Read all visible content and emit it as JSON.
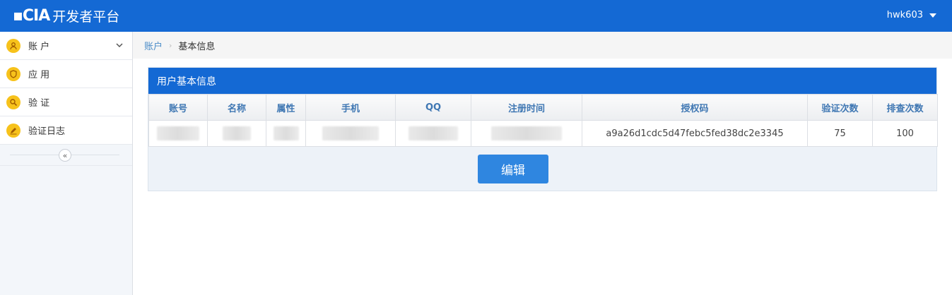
{
  "header": {
    "logo_mark": "▪CIA",
    "title": "开发者平台",
    "username": "hwk603"
  },
  "sidebar": {
    "items": [
      {
        "label": "账 户",
        "icon": "user-icon",
        "expandable": true
      },
      {
        "label": "应 用",
        "icon": "shield-icon",
        "expandable": false
      },
      {
        "label": "验 证",
        "icon": "search-icon",
        "expandable": false
      },
      {
        "label": "验证日志",
        "icon": "pencil-icon",
        "expandable": false
      }
    ],
    "collapse_glyph": "«"
  },
  "breadcrumb": {
    "parent": "账户",
    "separator": "›",
    "current": "基本信息"
  },
  "panel": {
    "title": "用户基本信息",
    "columns": [
      "账号",
      "名称",
      "属性",
      "手机",
      "QQ",
      "注册时间",
      "授权码",
      "验证次数",
      "排查次数"
    ],
    "row": {
      "account": "",
      "name": "",
      "attribute": "",
      "phone": "",
      "qq": "",
      "register_time": "",
      "auth_code": "a9a26d1cdc5d47febc5fed38dc2e3345",
      "verify_count": "75",
      "check_count": "100"
    },
    "edit_button": "编辑"
  },
  "colors": {
    "primary": "#1469d4",
    "button": "#2f86e0",
    "icon_bg": "#f7c21b",
    "link": "#4a8cc8"
  }
}
